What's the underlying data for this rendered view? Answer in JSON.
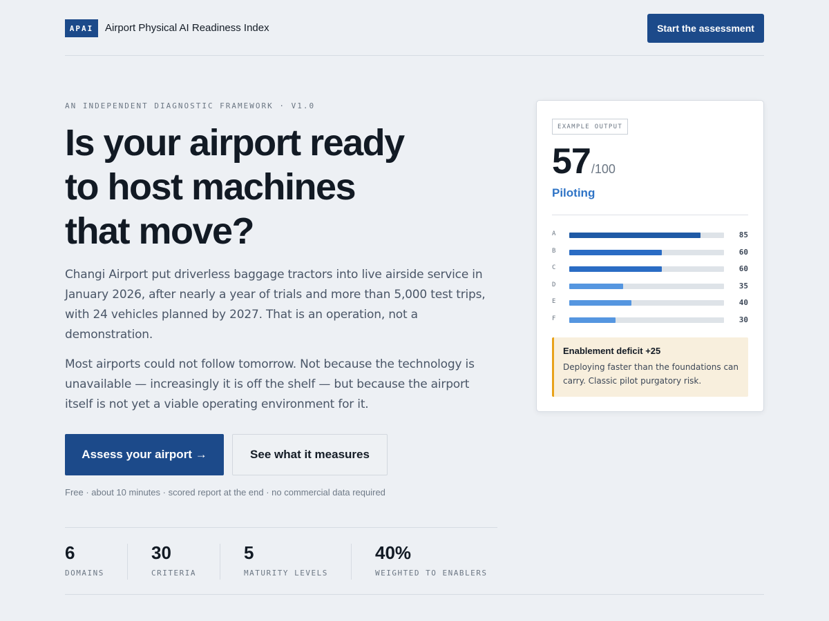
{
  "header": {
    "logo_text": "APAI",
    "title": "Airport Physical AI Readiness Index",
    "cta_label": "Start the assessment"
  },
  "hero": {
    "eyebrow": "AN INDEPENDENT DIAGNOSTIC FRAMEWORK · V1.0",
    "headline_lines": [
      "Is your airport ready",
      "to host machines",
      "that move?"
    ],
    "paragraph1": "Changi Airport put driverless baggage tractors into live airside service in January 2026, after nearly a year of trials and more than 5,000 test trips, with 24 vehicles planned by 2027. That is an operation, not a demonstration.",
    "paragraph2": "Most airports could not follow tomorrow. Not because the technology is unavailable — increasingly it is off the shelf — but because the airport itself is not yet a viable operating environment for it.",
    "primary_button": "Assess your airport →",
    "secondary_button": "See what it measures",
    "fineprint": "Free · about 10 minutes · scored report at the end · no commercial data required"
  },
  "stats": [
    {
      "value": "6",
      "label": "DOMAINS"
    },
    {
      "value": "30",
      "label": "CRITERIA"
    },
    {
      "value": "5",
      "label": "MATURITY LEVELS"
    },
    {
      "value": "40%",
      "label": "WEIGHTED TO ENABLERS"
    }
  ],
  "card": {
    "tag": "EXAMPLE OUTPUT",
    "score": "57",
    "score_max": "/100",
    "status": "Piloting",
    "domains": [
      {
        "letter": "A",
        "score": 85,
        "color": "#1f5aa6"
      },
      {
        "letter": "B",
        "score": 60,
        "color": "#2a6cc4"
      },
      {
        "letter": "C",
        "score": 60,
        "color": "#2a6cc4"
      },
      {
        "letter": "D",
        "score": 35,
        "color": "#5596e0"
      },
      {
        "letter": "E",
        "score": 40,
        "color": "#5596e0"
      },
      {
        "letter": "F",
        "score": 30,
        "color": "#5596e0"
      }
    ],
    "callout_title": "Enablement deficit +25",
    "callout_body": "Deploying faster than the foundations can carry. Classic pilot purgatory risk."
  },
  "colors": {
    "brand": "#1c4a8a",
    "accent": "#2f74c6",
    "warning": "#e8a21a",
    "background": "#edf0f4"
  }
}
